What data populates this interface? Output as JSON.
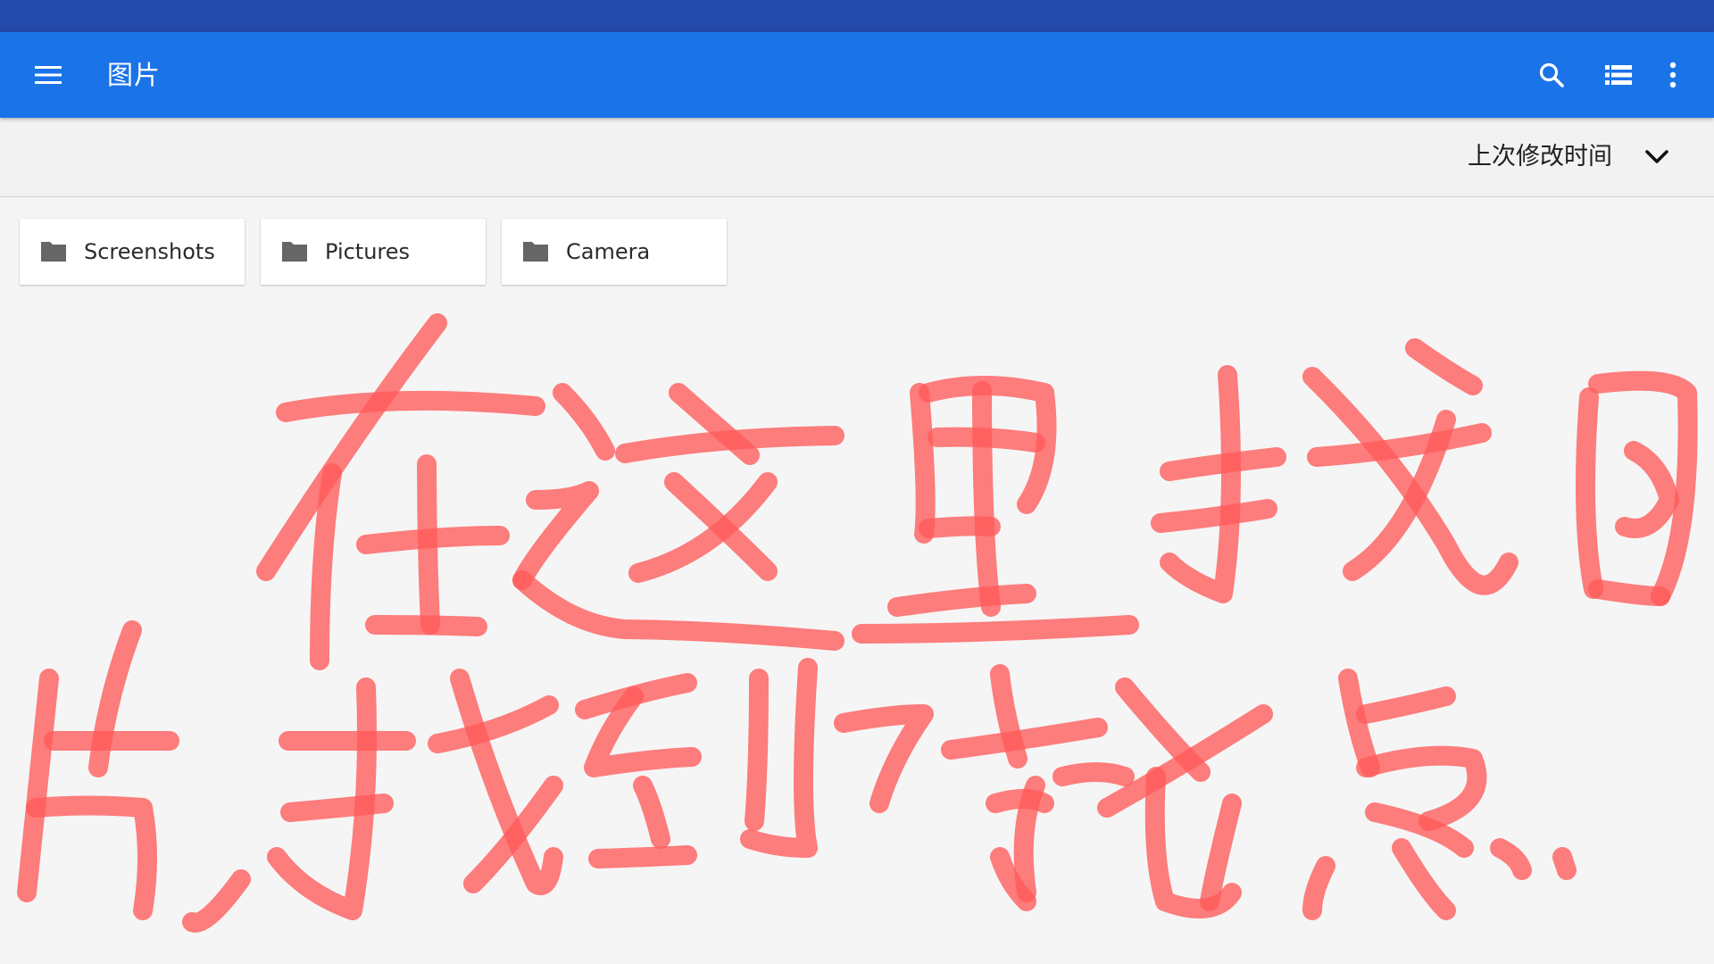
{
  "app_bar": {
    "title": "图片",
    "menu_icon": "hamburger-menu-icon",
    "actions": [
      "search-icon",
      "list-view-icon",
      "more-vert-icon"
    ],
    "color": "#1b73e8"
  },
  "status_bar": {
    "color": "#2349aa"
  },
  "sort_bar": {
    "label": "上次修改时间",
    "icon": "chevron-down-icon"
  },
  "folders": [
    {
      "name": "Screenshots",
      "icon": "folder-icon"
    },
    {
      "name": "Pictures",
      "icon": "folder-icon"
    },
    {
      "name": "Camera",
      "icon": "folder-icon"
    }
  ],
  "annotation": {
    "text": "在这里找图片,找到后就点.",
    "color": "#ff5a5a"
  }
}
